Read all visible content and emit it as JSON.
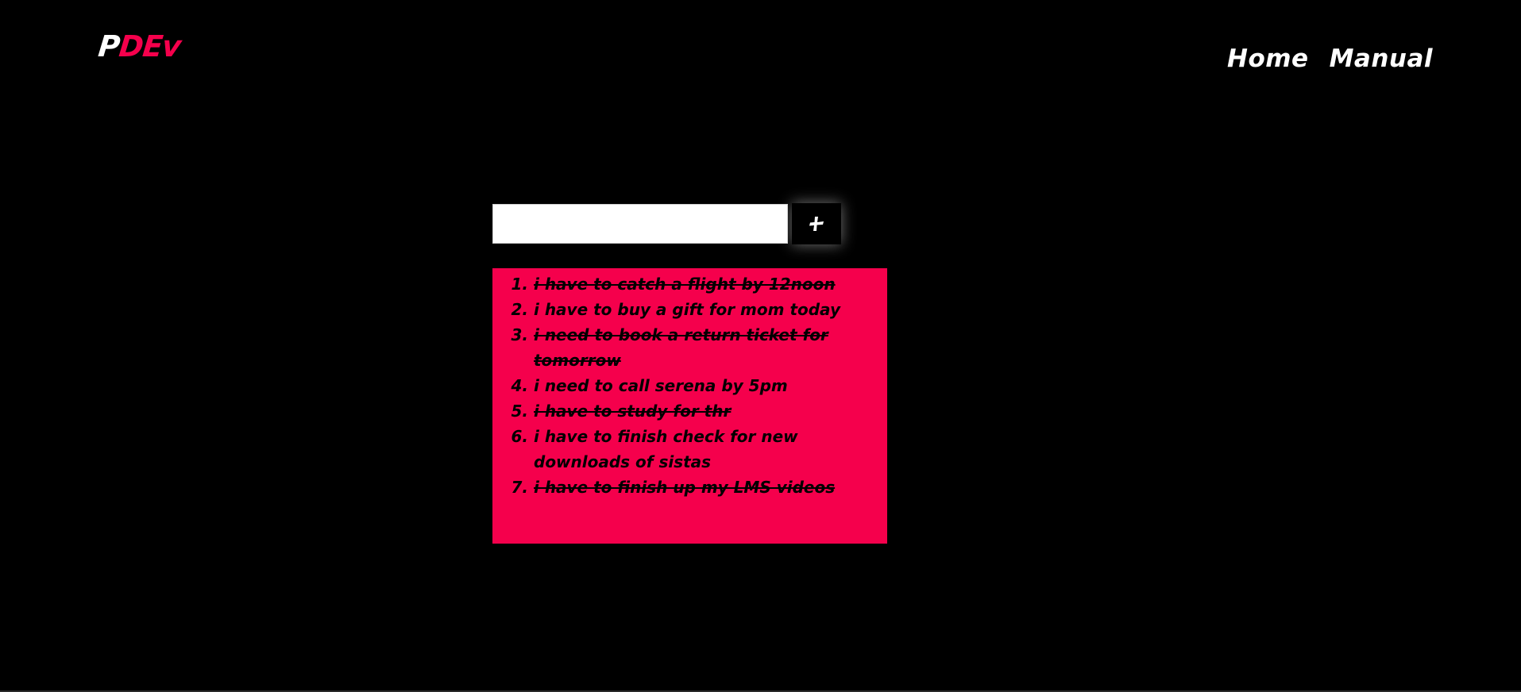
{
  "header": {
    "logo": {
      "first_letter": "P",
      "rest": "DEv"
    },
    "nav": [
      {
        "label": "Home"
      },
      {
        "label": "Manual"
      }
    ]
  },
  "task_input": {
    "value": "",
    "placeholder": ""
  },
  "add_button": {
    "icon": "plus-icon"
  },
  "todos": [
    {
      "text": "i have to catch a flight by 12noon",
      "done": true
    },
    {
      "text": "i have to buy a gift for mom today",
      "done": false
    },
    {
      "text": "i need to book a return ticket for tomorrow",
      "done": true
    },
    {
      "text": "i need to call serena by 5pm",
      "done": false
    },
    {
      "text": "i have to study for thr",
      "done": true
    },
    {
      "text": "i have to finish check for new downloads of sistas",
      "done": false
    },
    {
      "text": "i have to finish up my LMS videos",
      "done": true
    }
  ],
  "colors": {
    "background": "#000000",
    "accent": "#f5004c",
    "text_light": "#ffffff",
    "text_dark": "#000000"
  }
}
